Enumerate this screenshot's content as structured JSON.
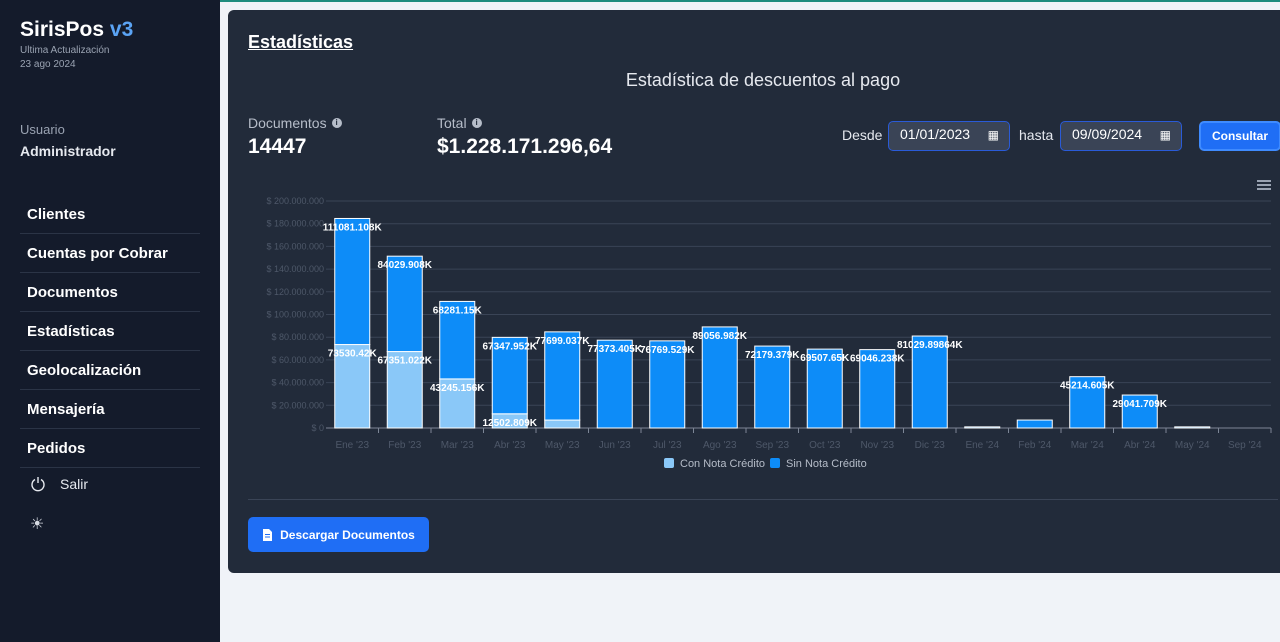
{
  "sidebar": {
    "brand": "SirisPos",
    "version": "v3",
    "updated_label": "Ultima Actualización",
    "updated_date": "23 ago 2024",
    "user_label": "Usuario",
    "user_name": "Administrador",
    "items": [
      {
        "label": "Clientes"
      },
      {
        "label": "Cuentas por Cobrar"
      },
      {
        "label": "Documentos"
      },
      {
        "label": "Estadísticas"
      },
      {
        "label": "Geolocalización"
      },
      {
        "label": "Mensajería"
      },
      {
        "label": "Pedidos"
      }
    ],
    "logout_label": "Salir",
    "logout_icon": "power-icon",
    "theme_icon": "sun-icon"
  },
  "main": {
    "title": "Estadísticas",
    "subtitle": "Estadística de descuentos al pago",
    "documents_label": "Documentos",
    "documents_value": "14447",
    "total_label": "Total",
    "total_value": "$1.228.171.296,64",
    "from_label": "Desde",
    "from_value": "01/01/2023",
    "to_label": "hasta",
    "to_value": "09/09/2024",
    "submit_label": "Consultar",
    "download_label": "Descargar Documentos"
  },
  "colors": {
    "con": "#8ac8f8",
    "sin": "#0d8cf8",
    "accent": "#1f6ef5"
  },
  "chart_data": {
    "type": "bar",
    "stacked": true,
    "categories": [
      "Ene '23",
      "Feb '23",
      "Mar '23",
      "Abr '23",
      "May '23",
      "Jun '23",
      "Jul '23",
      "Ago '23",
      "Sep '23",
      "Oct '23",
      "Nov '23",
      "Dic '23",
      "Ene '24",
      "Feb '24",
      "Mar '24",
      "Abr '24",
      "May '24",
      "Sep '24"
    ],
    "series": [
      {
        "name": "Con Nota Crédito",
        "values": [
          73530420,
          67351022,
          43245156,
          12502809,
          7000000,
          0,
          0,
          0,
          0,
          0,
          0,
          0,
          0,
          0,
          0,
          0,
          0,
          0
        ],
        "labels": [
          "73530.42K",
          "67351.022K",
          "43245.156K",
          "12502.809K",
          "",
          "",
          "",
          "",
          "",
          "",
          "",
          "",
          "",
          "",
          "",
          "",
          "",
          ""
        ]
      },
      {
        "name": "Sin Nota Crédito",
        "values": [
          111081108,
          84029908,
          68281150,
          67347952,
          77699037,
          77373405,
          76769529,
          89056982,
          72179379,
          69507650,
          69046238,
          81029898,
          1000000,
          7000000,
          45214605,
          29041709,
          1000000,
          0
        ],
        "labels": [
          "111081.108K",
          "84029.908K",
          "68281.15K",
          "67347.952K",
          "77699.037K",
          "77373.405K",
          "76769.529K",
          "89056.982K",
          "72179.379K",
          "69507.65K",
          "69046.238K",
          "81029.89864K",
          "",
          "",
          "45214.605K",
          "29041.709K",
          "",
          ""
        ]
      }
    ],
    "y_ticks": [
      "$ 0",
      "$ 20.000.000",
      "$ 40.000.000",
      "$ 60.000.000",
      "$ 80.000.000",
      "$ 100.000.000",
      "$ 120.000.000",
      "$ 140.000.000",
      "$ 160.000.000",
      "$ 180.000.000",
      "$ 200.000.000"
    ],
    "ylim": [
      0,
      200000000
    ],
    "grid": true,
    "legend": "bottom"
  }
}
